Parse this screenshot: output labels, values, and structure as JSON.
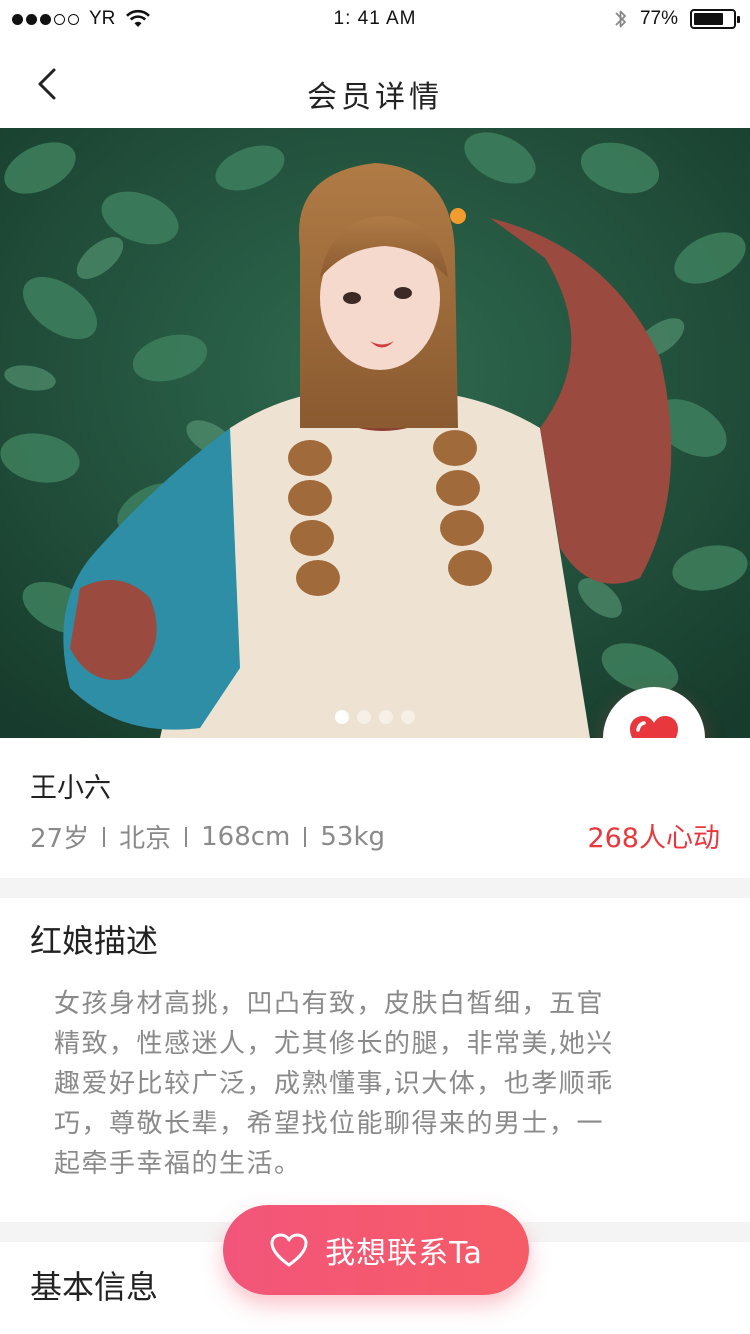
{
  "status_bar": {
    "carrier": "YR",
    "time": "1: 41 AM",
    "battery_text": "77%",
    "battery_level": 0.77
  },
  "nav": {
    "title": "会员详情"
  },
  "carousel": {
    "page_count": 4,
    "current_page": 1
  },
  "profile": {
    "name": "王小六",
    "age": "27岁",
    "city": "北京",
    "height": "168cm",
    "weight": "53kg",
    "hearts_text": "268人心动"
  },
  "description": {
    "title": "红娘描述",
    "lines": [
      "女孩身材高挑，凹凸有致，皮肤白皙细，五官",
      "精致，性感迷人，尤其修长的腿，非常美,她兴",
      "趣爱好比较广泛，成熟懂事,识大体，也孝顺乖",
      "巧，尊敬长辈，希望找位能聊得来的男士，一",
      "起牵手幸福的生活。"
    ]
  },
  "basic_info": {
    "title": "基本信息"
  },
  "contact": {
    "label": "我想联系Ta"
  },
  "colors": {
    "accent": "#e8383d",
    "button_gradient_start": "#f2557a",
    "button_gradient_end": "#f65c66"
  }
}
